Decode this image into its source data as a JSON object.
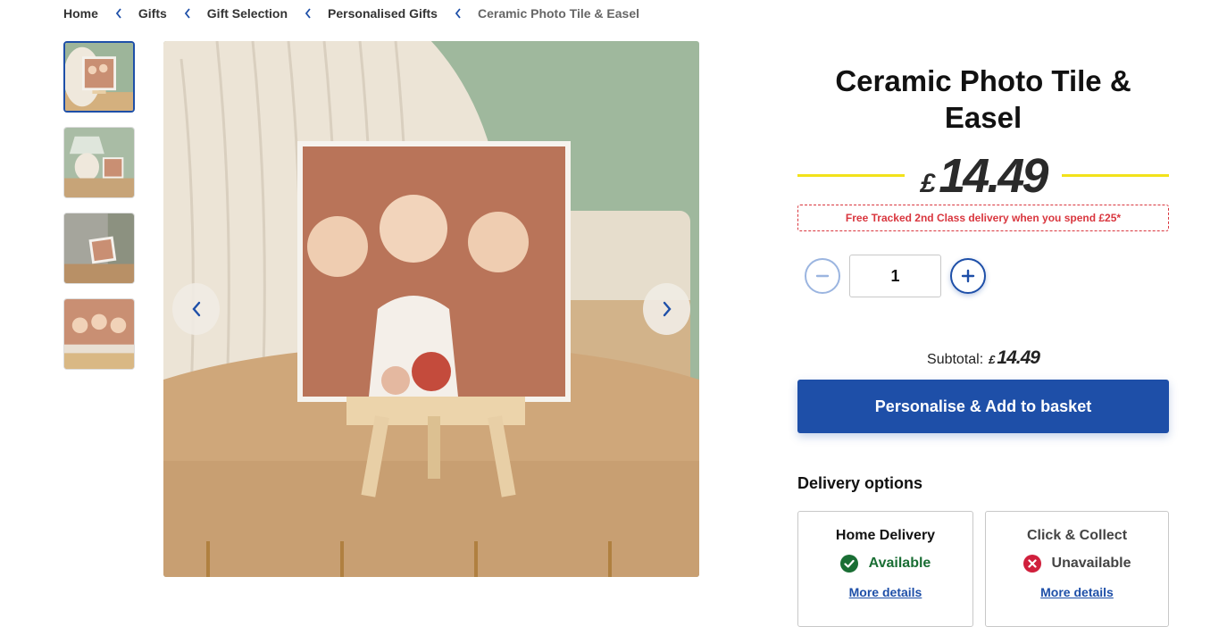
{
  "breadcrumb": {
    "items": [
      "Home",
      "Gifts",
      "Gift Selection",
      "Personalised Gifts"
    ],
    "current": "Ceramic Photo Tile & Easel"
  },
  "gallery": {
    "thumbnails": [
      "tile-on-easel",
      "lamp-and-tile",
      "tile-on-chair",
      "tile-close-up"
    ],
    "selected_index": 0
  },
  "product": {
    "title": "Ceramic Photo Tile & Easel",
    "currency": "£",
    "price": "14.49",
    "delivery_note": "Free Tracked 2nd Class delivery when you spend £25*",
    "quantity": "1",
    "subtotal_label": "Subtotal:",
    "subtotal_currency": "£",
    "subtotal_amount": "14.49",
    "add_button": "Personalise & Add to basket"
  },
  "delivery": {
    "heading": "Delivery options",
    "options": [
      {
        "title": "Home Delivery",
        "status": "Available",
        "link": "More details"
      },
      {
        "title": "Click & Collect",
        "status": "Unavailable",
        "link": "More details"
      }
    ]
  },
  "colors": {
    "brand_blue": "#1e4fa8",
    "price_line": "#f2e21a",
    "alert_red": "#d9363e",
    "available_green": "#1a6e34"
  }
}
